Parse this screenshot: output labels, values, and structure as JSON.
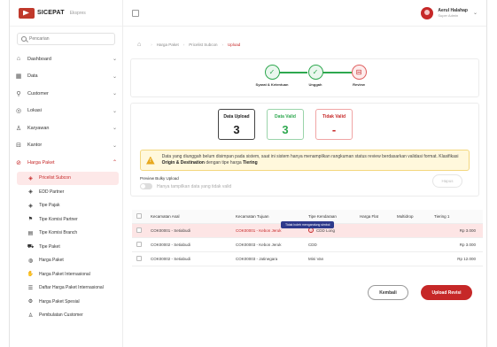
{
  "brand": {
    "name": "SICEPAT",
    "sub": "Ekspres"
  },
  "search": {
    "placeholder": "Pencarian"
  },
  "sidebar": {
    "items": [
      {
        "label": "Dashboard",
        "icon": "home-icon"
      },
      {
        "label": "Data",
        "icon": "grid-icon"
      },
      {
        "label": "Customer",
        "icon": "user-plus-icon"
      },
      {
        "label": "Lokasi",
        "icon": "location-icon"
      },
      {
        "label": "Karyawan",
        "icon": "users-icon"
      },
      {
        "label": "Kantor",
        "icon": "office-icon"
      },
      {
        "label": "Harga Paket",
        "icon": "tag-icon"
      }
    ],
    "subitems": [
      {
        "label": "Pricelist Subcon",
        "icon": "price-tag-icon",
        "active": true
      },
      {
        "label": "EDD Partner",
        "icon": "price-tag-icon"
      },
      {
        "label": "Tipe Pajak",
        "icon": "price-tag-icon"
      },
      {
        "label": "Tipe Komisi Partner",
        "icon": "flag-icon"
      },
      {
        "label": "Tipe Komisi Branch",
        "icon": "building-icon"
      },
      {
        "label": "Tipe Paket",
        "icon": "truck-icon"
      },
      {
        "label": "Harga Paket",
        "icon": "coin-icon"
      },
      {
        "label": "Harga Paket Internasional",
        "icon": "handshake-icon"
      },
      {
        "label": "Daftar Harga Paket Internasional",
        "icon": "list-icon"
      },
      {
        "label": "Harga Paket Spesial",
        "icon": "gear-icon"
      },
      {
        "label": "Pembulatan Customer",
        "icon": "users-icon"
      }
    ]
  },
  "user": {
    "name": "Aerul Halahap",
    "role": "Super Admin"
  },
  "breadcrumb": {
    "items": [
      "Harga Paket",
      "Pricelist Subcon"
    ],
    "current": "Upload"
  },
  "steps": [
    {
      "label": "Syarat & Ketentuan",
      "icon": "✓"
    },
    {
      "label": "Unggah",
      "icon": "✓"
    },
    {
      "label": "Review",
      "icon": "⊟"
    }
  ],
  "stats": {
    "upload": {
      "title": "Data Upload",
      "value": "3"
    },
    "valid": {
      "title": "Data Valid",
      "value": "3"
    },
    "invalid": {
      "title": "Tidak Valid",
      "value": "-"
    }
  },
  "alert": {
    "text_1": "Data yang diunggah belum disimpan pada sistem, saat ini sistem hanya menampilkan rangkuman status review berdasarkan validasi format. Klasifikasi ",
    "bold_1": "Origin & Destination",
    "text_2": " dengan tipe harga ",
    "bold_2": "Tiering"
  },
  "preview": {
    "title": "Preview Bulky Upload",
    "toggle_label": "Hanya tampilkan data yang tidak valid",
    "delete_label": "Hapus"
  },
  "table": {
    "columns": [
      "Kecamatan Asal",
      "Kecamatan Tujuan",
      "Tipe Kendaraan",
      "Harga Flat",
      "Multidrop",
      "Tiering 1"
    ],
    "rows": [
      {
        "asal": "COK00001 - Setiabudi",
        "tujuan": "COK00001 - Kebon Jeruk",
        "kendaraan": "CDD Long",
        "flat": "",
        "multidrop": "",
        "tiering": "Rp 3.000",
        "error": true
      },
      {
        "asal": "COK00002 - Setiabudi",
        "tujuan": "COK00003 - Kebon Jeruk",
        "kendaraan": "CDD",
        "flat": "",
        "multidrop": "",
        "tiering": "Rp 3.000",
        "error": false
      },
      {
        "asal": "COK00002 - Setiabudi",
        "tujuan": "COK00003 - Jatinegara",
        "kendaraan": "Mini Van",
        "flat": "",
        "multidrop": "",
        "tiering": "Rp 12.000",
        "error": false
      }
    ],
    "tooltip": "Tidak boleh mengandung simbol"
  },
  "buttons": {
    "back": "Kembali",
    "upload": "Upload Revisi"
  },
  "colors": {
    "primary": "#c62828",
    "success": "#2ea84f",
    "warning": "#e7a81c"
  }
}
